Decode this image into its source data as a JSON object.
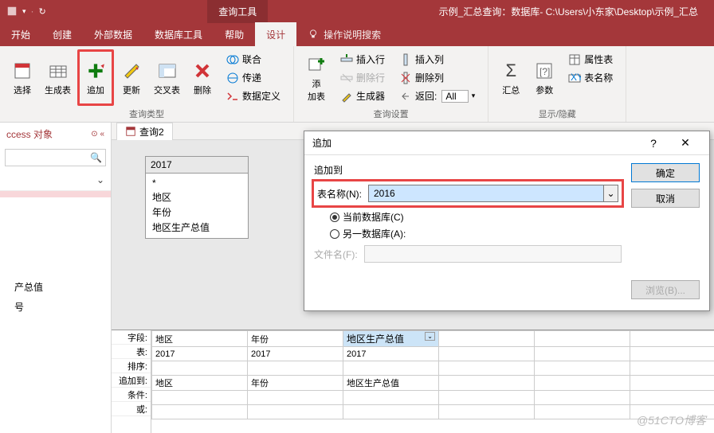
{
  "titlebar": {
    "context_tab": "查询工具",
    "title": "示例_汇总查询：数据库- C:\\Users\\小东家\\Desktop\\示例_汇总"
  },
  "tabs": {
    "t0": "开始",
    "t1": "创建",
    "t2": "外部数据",
    "t3": "数据库工具",
    "t4": "帮助",
    "t5": "设计",
    "tellme": "操作说明搜索"
  },
  "ribbon": {
    "g_querytype": {
      "select": "选择",
      "maketable": "生成表",
      "append": "追加",
      "update": "更新",
      "crosstab": "交叉表",
      "delete": "删除",
      "union": "联合",
      "passthrough": "传递",
      "datadef": "数据定义",
      "label": "查询类型"
    },
    "g_setup": {
      "addtable": "添\n加表",
      "insertrow": "插入行",
      "deleterow": "删除行",
      "builder": "生成器",
      "insertcol": "插入列",
      "deletecol": "删除列",
      "return": "返回:",
      "return_val": "All",
      "label": "查询设置"
    },
    "g_showhide": {
      "totals": "汇总",
      "params": "参数",
      "propsheet": "属性表",
      "tablenames": "表名称",
      "label": "显示/隐藏"
    }
  },
  "leftpane": {
    "header": "ccess 对象",
    "search_placeholder": "",
    "cat1": "",
    "item1": "",
    "item2_a": "产总值",
    "item2_b": "号"
  },
  "doctab": {
    "name": "查询2"
  },
  "fieldbox": {
    "title": "2017",
    "rows": [
      "*",
      "地区",
      "年份",
      "地区生产总值"
    ]
  },
  "qbe": {
    "labels": [
      "字段:",
      "表:",
      "排序:",
      "追加到:",
      "条件:",
      "或:"
    ],
    "cols": [
      {
        "field": "地区",
        "table": "2017",
        "append": "地区"
      },
      {
        "field": "年份",
        "table": "2017",
        "append": "年份"
      },
      {
        "field": "地区生产总值",
        "table": "2017",
        "append": "地区生产总值",
        "sel": true
      }
    ]
  },
  "dialog": {
    "title": "追加",
    "group": "追加到",
    "tablename_label": "表名称(N):",
    "tablename_value": "2016",
    "radio_current": "当前数据库(C)",
    "radio_other": "另一数据库(A):",
    "filename_label": "文件名(F):",
    "browse": "浏览(B)...",
    "ok": "确定",
    "cancel": "取消"
  },
  "watermark": "@51CTO博客"
}
